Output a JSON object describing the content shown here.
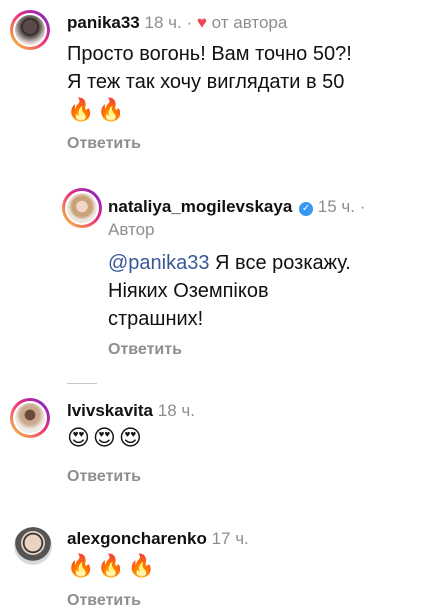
{
  "comments": [
    {
      "username": "panika33",
      "time": "18 ч.",
      "author_like": "от автора",
      "text_lines": [
        "Просто вогонь! Вам точно 50?!",
        "Я теж так хочу виглядати в 50"
      ],
      "emojis": "🔥🔥",
      "reply_label": "Ответить"
    },
    {
      "username": "nataliya_mogilevskaya",
      "time": "15 ч.",
      "author_tag": "Автор",
      "mention": "@panika33",
      "text_line1_rest": " Я все розкажу.",
      "text_lines": [
        "Ніяких Оземпіков",
        "страшних!"
      ],
      "reply_label": "Ответить"
    },
    {
      "username": "lvivskavita",
      "time": "18 ч.",
      "emojis": "😍😍😍",
      "reply_label": "Ответить"
    },
    {
      "username": "alexgoncharenko",
      "time": "17 ч.",
      "emojis": "🔥🔥🔥",
      "reply_label": "Ответить"
    }
  ],
  "icons": {
    "heart": "heart-icon",
    "verified": "verified-badge-icon"
  },
  "colors": {
    "muted": "#8e8e8e",
    "heart": "#ed4956",
    "mention": "#385898",
    "verified": "#3897f0"
  }
}
